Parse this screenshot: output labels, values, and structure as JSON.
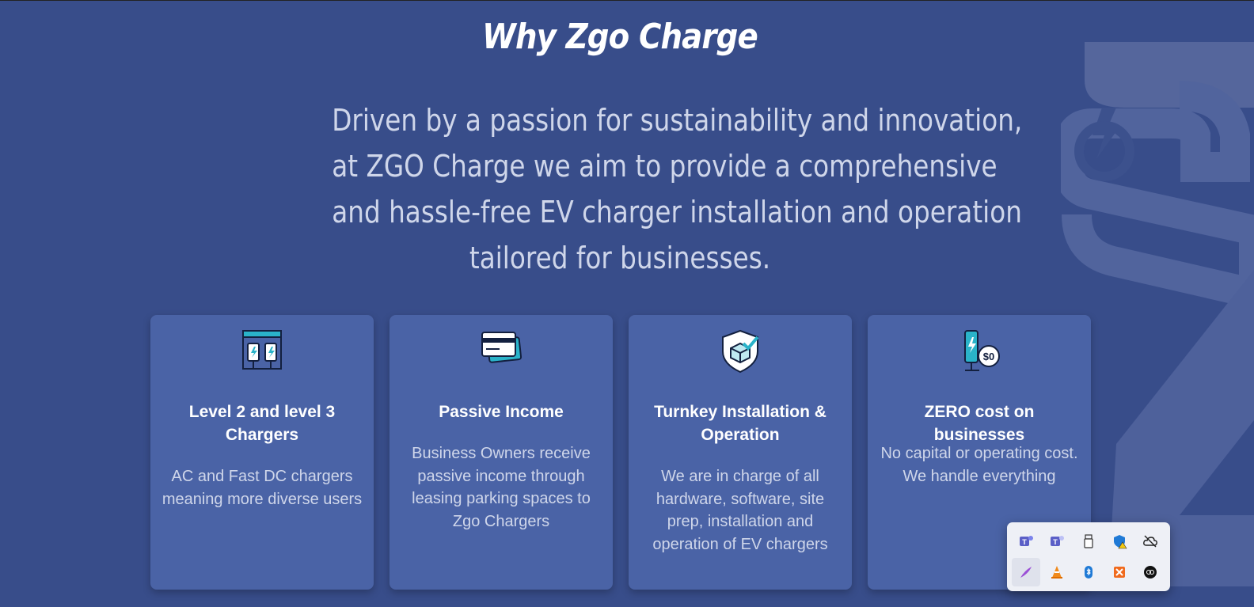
{
  "section": {
    "title": "Why Zgo Charge",
    "intro_lines": [
      "Driven by a passion for sustainability and innovation,",
      "at ZGO Charge we aim to provide a comprehensive",
      "and hassle-free EV charger installation and operation",
      "tailored for businesses."
    ]
  },
  "cards": [
    {
      "icon": "charging-station-icon",
      "title": "Level 2 and level 3 Chargers",
      "description": "AC and Fast DC chargers meaning more diverse users"
    },
    {
      "icon": "credit-card-icon",
      "title": "Passive Income",
      "description": "Business Owners receive passive income through leasing parking spaces to Zgo Chargers"
    },
    {
      "icon": "shield-package-icon",
      "title": "Turnkey Installation & Operation",
      "description": "We are in charge of all hardware, software, site prep, installation and operation of EV chargers"
    },
    {
      "icon": "charger-zero-cost-icon",
      "title": "ZERO cost on businesses",
      "description": "No capital or operating cost. We handle everything",
      "badge": "$0"
    }
  ],
  "tray_icons": [
    "teams-icon",
    "teams-icon",
    "usb-drive-icon",
    "windows-security-warning-icon",
    "cloud-offline-icon",
    "feather-pen-icon",
    "vlc-icon",
    "bluetooth-icon",
    "xampp-icon",
    "app-badge-icon"
  ],
  "colors": {
    "background": "#384d8a",
    "card": "#4a63a6",
    "accent_teal": "#2ab3c9",
    "text_muted": "#cfd6ea"
  }
}
